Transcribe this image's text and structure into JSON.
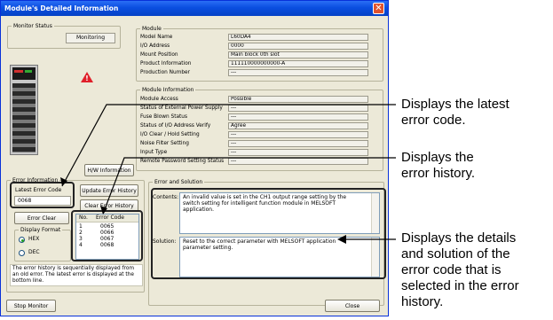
{
  "window": {
    "title": "Module's Detailed Information"
  },
  "monitor": {
    "label": "Monitor Status",
    "button": "Monitoring"
  },
  "module": {
    "label": "Module",
    "rows": [
      {
        "key": "Model Name",
        "value": "L60DA4"
      },
      {
        "key": "I/O Address",
        "value": "0000"
      },
      {
        "key": "Mount Position",
        "value": "Main block 0th slot"
      },
      {
        "key": "Product Information",
        "value": "111110000000000-A"
      },
      {
        "key": "Production Number",
        "value": "---"
      }
    ]
  },
  "module_info": {
    "label": "Module Information",
    "rows": [
      {
        "key": "Module Access",
        "value": "Possible"
      },
      {
        "key": "Status of External Power Supply",
        "value": "---"
      },
      {
        "key": "Fuse Blown Status",
        "value": "---"
      },
      {
        "key": "Status of I/O Address Verify",
        "value": "Agree"
      },
      {
        "key": "I/O Clear / Hold Setting",
        "value": "---"
      },
      {
        "key": "Noise Filter Setting",
        "value": "---"
      },
      {
        "key": "Input Type",
        "value": "---"
      },
      {
        "key": "Remote Password Setting Status",
        "value": "---"
      }
    ]
  },
  "hw_button": "H/W Information",
  "error_info": {
    "label": "Error Information",
    "latest_label": "Latest Error Code",
    "latest_value": "0068",
    "update_button": "Update Error History",
    "clear_history_button": "Clear Error History",
    "error_clear_button": "Error Clear",
    "display_format": {
      "label": "Display Format",
      "options": [
        "HEX",
        "DEC"
      ],
      "selected": "HEX"
    },
    "history": {
      "headers": [
        "No.",
        "Error Code"
      ],
      "rows": [
        {
          "no": "1",
          "code": "0065"
        },
        {
          "no": "2",
          "code": "0066"
        },
        {
          "no": "3",
          "code": "0067"
        },
        {
          "no": "4",
          "code": "0068"
        }
      ]
    },
    "note": "The error history is sequentially displayed from an old error. The latest error is displayed at the bottom line."
  },
  "error_solution": {
    "label": "Error and Solution",
    "contents_label": "Contents:",
    "contents_text": "An invalid value is set in the CH1 output range setting by the switch setting for intelligent function module in MELSOFT application.",
    "solution_label": "Solution:",
    "solution_text": "Reset to the correct parameter with MELSOFT application parameter setting."
  },
  "footer": {
    "stop_button": "Stop Monitor",
    "close_button": "Close"
  },
  "annotations": {
    "latest": [
      "Displays the latest",
      "error code."
    ],
    "history": [
      "Displays the",
      "error history."
    ],
    "details": [
      "Displays the details",
      "and solution of the",
      "error code that is",
      "selected in the error",
      "history."
    ]
  },
  "colors": {
    "titlebar": "#0a4ee0",
    "window_bg": "#ece9d8",
    "selected_row": "#316ac5",
    "warning": "#e0202a"
  }
}
